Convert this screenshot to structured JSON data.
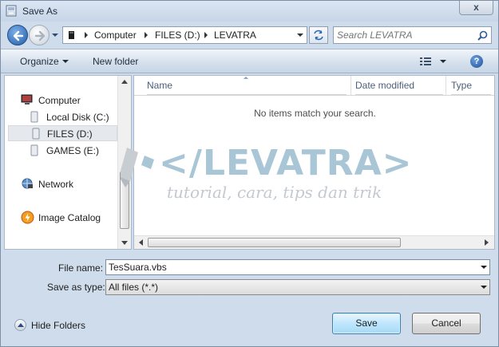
{
  "window": {
    "title": "Save As",
    "close_label": "x"
  },
  "address": {
    "crumbs": [
      "Computer",
      "FILES (D:)",
      "LEVATRA"
    ]
  },
  "search": {
    "placeholder": "Search LEVATRA"
  },
  "toolbar": {
    "organize_label": "Organize",
    "new_folder_label": "New folder",
    "help_label": "?"
  },
  "sidebar": {
    "items": [
      {
        "label": "Computer",
        "icon": "computer-icon"
      },
      {
        "label": "Local Disk (C:)",
        "icon": "drive-icon"
      },
      {
        "label": "FILES (D:)",
        "icon": "drive-icon",
        "selected": true
      },
      {
        "label": "GAMES (E:)",
        "icon": "drive-icon"
      },
      {
        "label": "Network",
        "icon": "network-icon"
      },
      {
        "label": "Image Catalog",
        "icon": "image-catalog-icon"
      }
    ]
  },
  "file_list": {
    "columns": [
      "Name",
      "Date modified",
      "Type"
    ],
    "empty_message": "No items match your search."
  },
  "watermark": {
    "main": "</LEVATRA>",
    "sub": "tutorial, cara, tips dan trik"
  },
  "form": {
    "file_name_label": "File name:",
    "file_name_value": "TesSuara.vbs",
    "save_as_type_label": "Save as type:",
    "save_as_type_value": "All files (*.*)"
  },
  "footer": {
    "hide_folders_label": "Hide Folders",
    "save_label": "Save",
    "cancel_label": "Cancel"
  },
  "colors": {
    "window_frame": "#cfdcec",
    "save_button": "#bee6fd",
    "watermark": "#a9c6d6"
  }
}
